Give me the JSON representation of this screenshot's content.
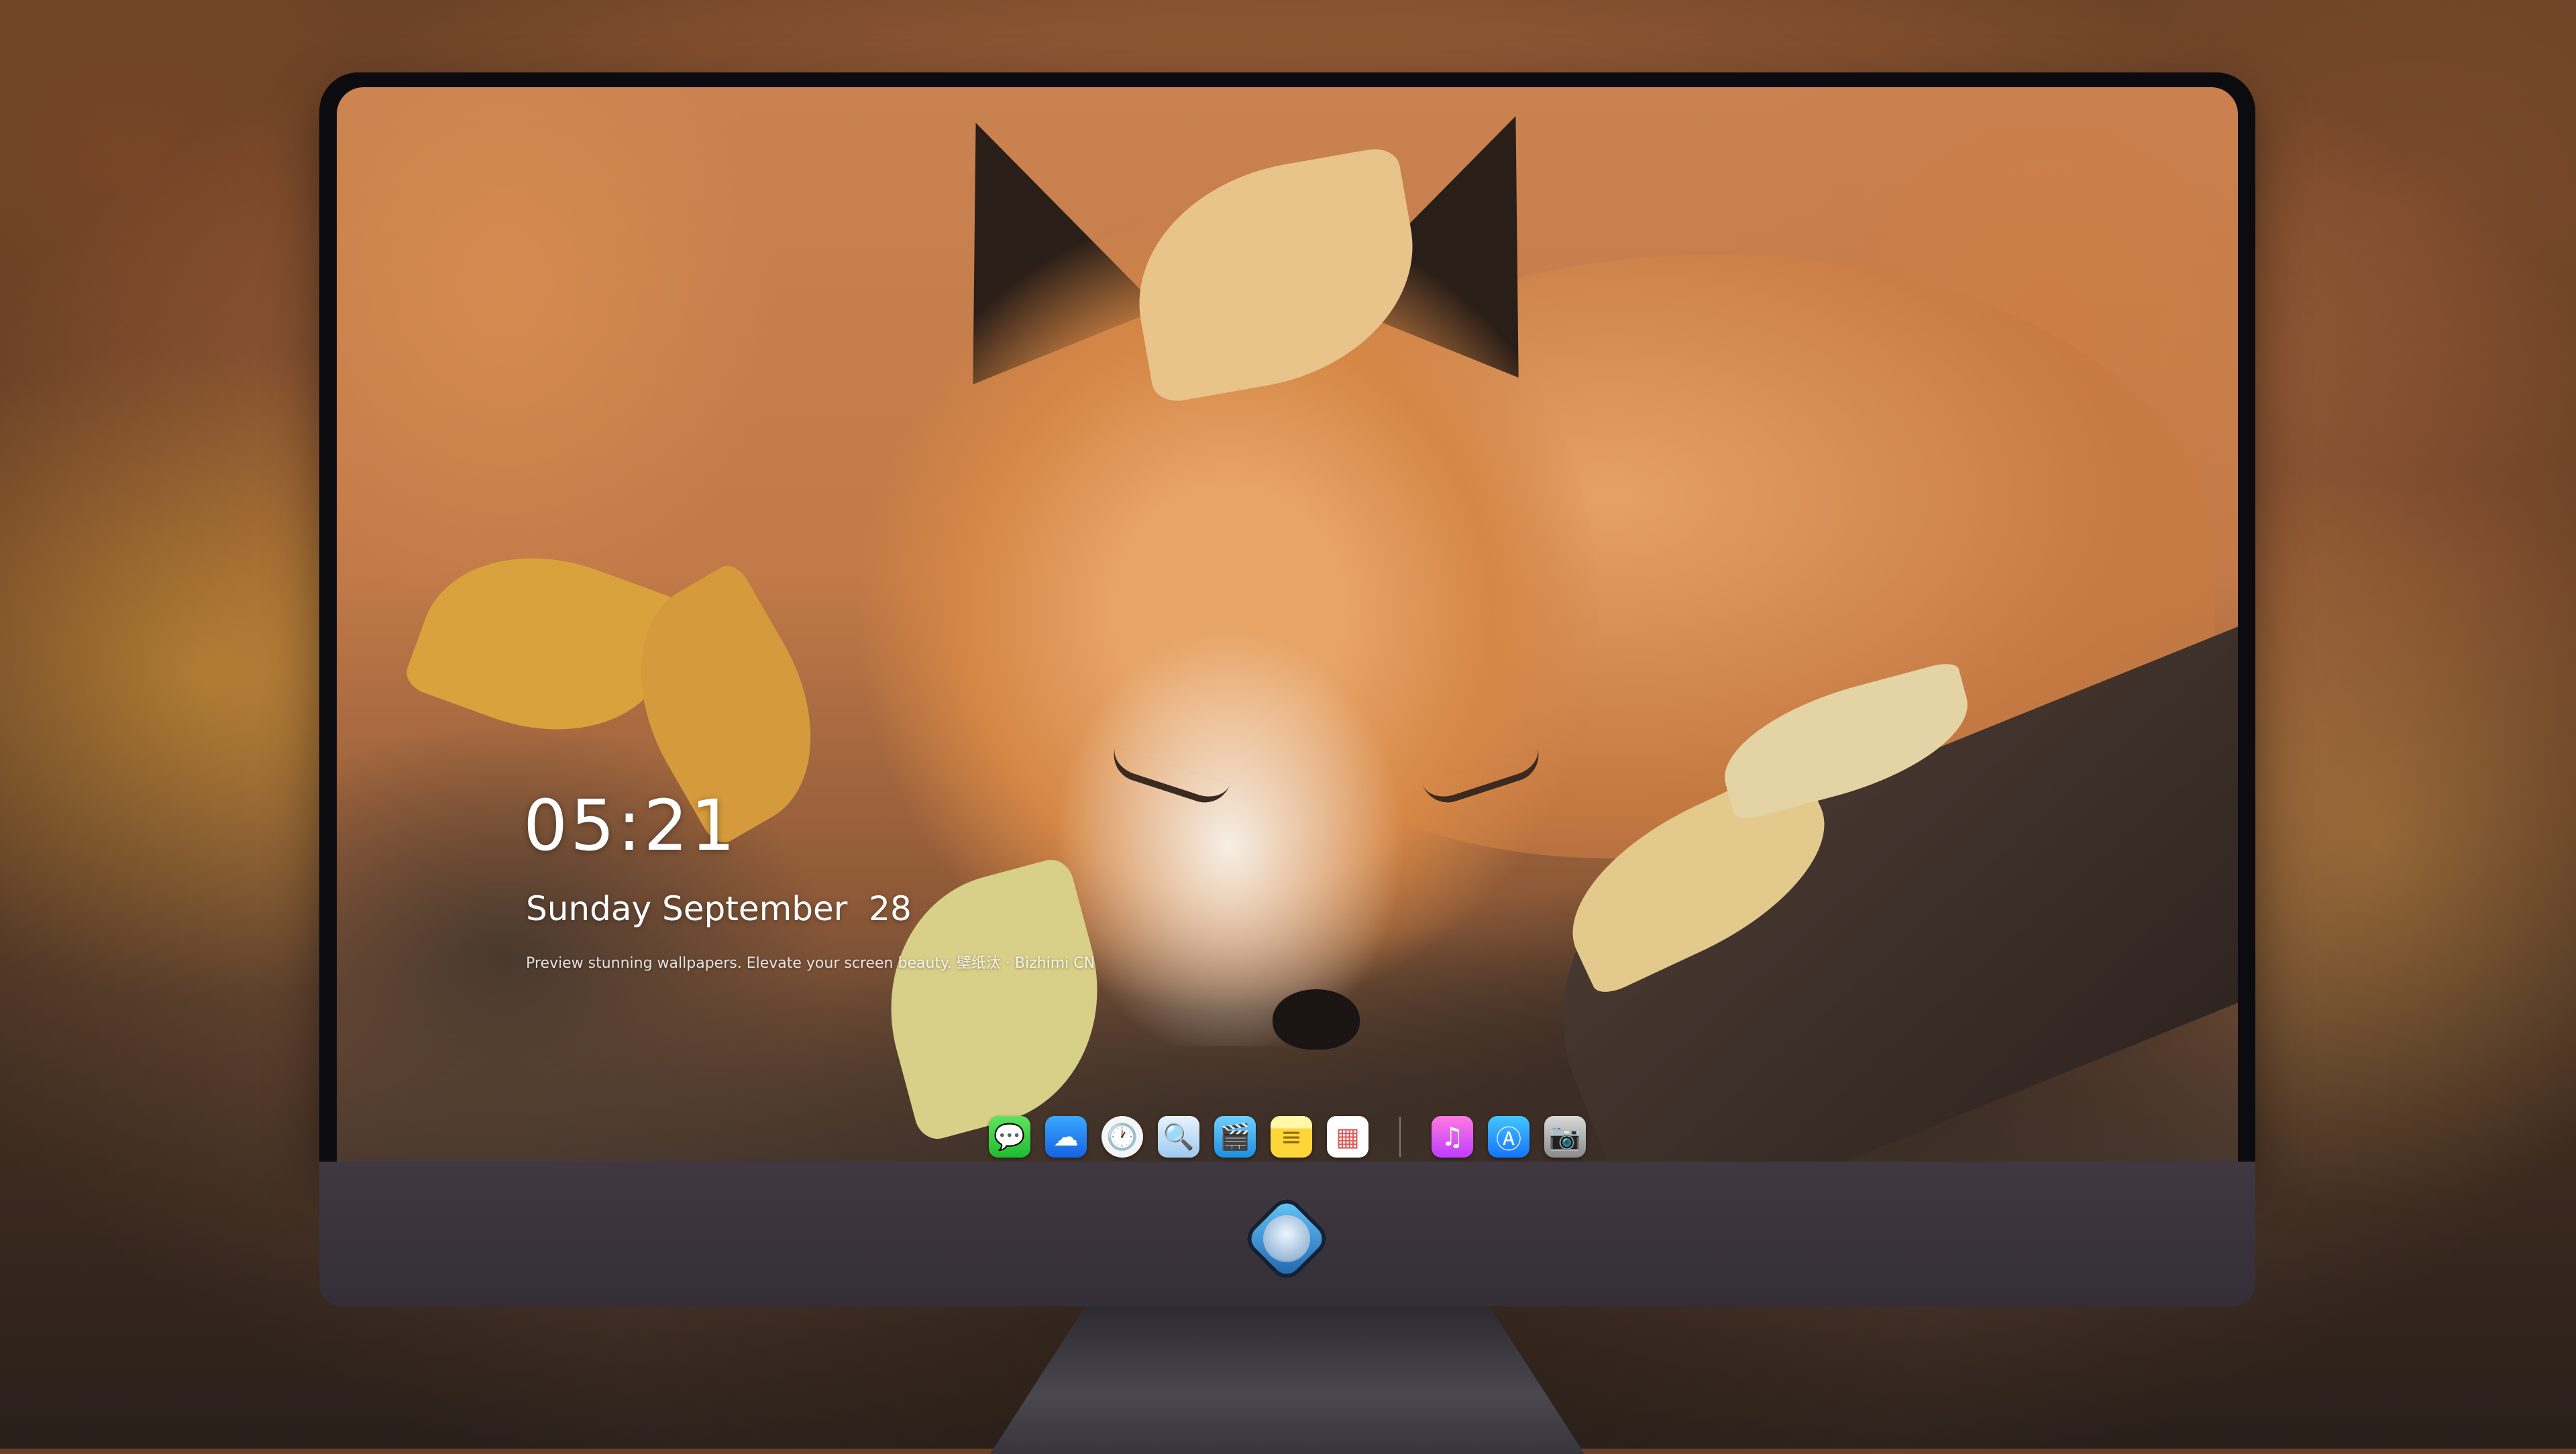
{
  "lockscreen": {
    "time": "05:21",
    "date": "Sunday September  28",
    "tagline": "Preview stunning wallpapers. Elevate your screen beauty. 壁纸汰 · Bizhimi CN"
  },
  "dock": {
    "apps_left": [
      {
        "name": "messages-icon",
        "glyph": "💬"
      },
      {
        "name": "weather-icon",
        "glyph": "☁"
      },
      {
        "name": "clock-icon",
        "glyph": "🕐"
      },
      {
        "name": "preview-icon",
        "glyph": "🔍"
      },
      {
        "name": "clips-icon",
        "glyph": "🎬"
      },
      {
        "name": "notes-icon",
        "glyph": "≡"
      },
      {
        "name": "photos-icon",
        "glyph": "▦"
      }
    ],
    "apps_right": [
      {
        "name": "music-icon",
        "glyph": "♫"
      },
      {
        "name": "app-store-icon",
        "glyph": "Ⓐ"
      },
      {
        "name": "camera-icon",
        "glyph": "📷"
      }
    ]
  },
  "colors": {
    "bezel": "#0c0c10",
    "chin": "#3a333b",
    "wallpaper_accent": "#c98250"
  }
}
